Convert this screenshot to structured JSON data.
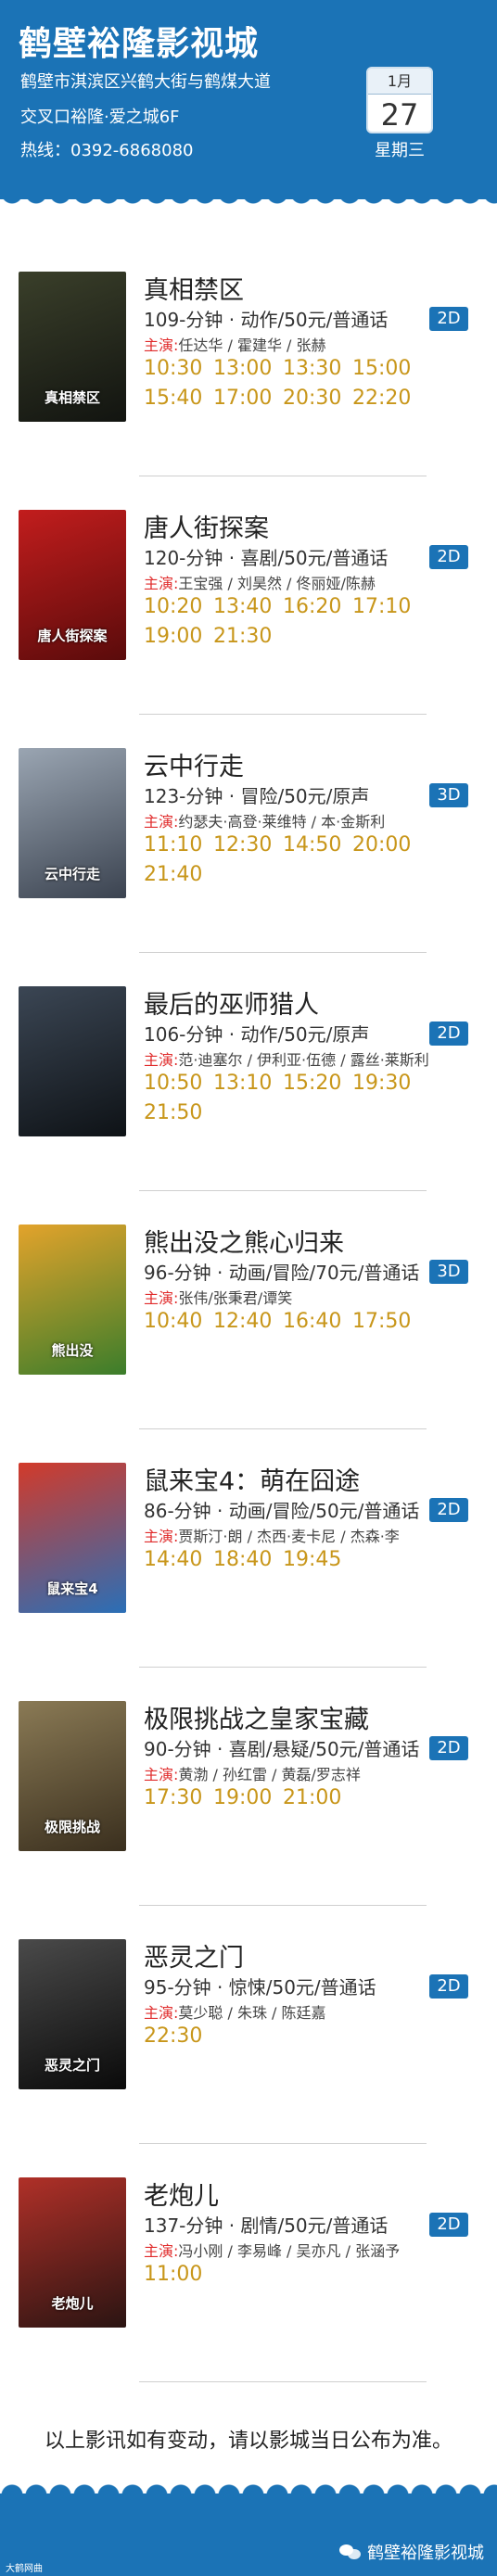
{
  "header": {
    "cinema_name": "鹤壁裕隆影视城",
    "address_line1": "鹤壁市淇滨区兴鹤大街与鹤煤大道",
    "address_line2": "交叉口裕隆·爱之城6F",
    "hotline": "热线：0392-6868080",
    "date_month": "1月",
    "date_day": "27",
    "weekday": "星期三"
  },
  "movies": [
    {
      "title": "真相禁区",
      "info": "109-分钟 · 动作/50元/普通话",
      "format": "2D",
      "cast_label": "主演:",
      "cast": "任达华 / 霍建华 / 张赫",
      "poster_text": "真相禁区",
      "poster_colors": [
        "#3a3f2a",
        "#121410"
      ],
      "times": [
        "10:30",
        "13:00",
        "13:30",
        "15:00",
        "15:40",
        "17:00",
        "20:30",
        "22:20"
      ]
    },
    {
      "title": "唐人街探案",
      "info": "120-分钟 · 喜剧/50元/普通话",
      "format": "2D",
      "cast_label": "主演:",
      "cast": "王宝强 / 刘昊然 / 佟丽娅/陈赫",
      "poster_text": "唐人街探案",
      "poster_colors": [
        "#c21d1d",
        "#5a0b0b"
      ],
      "times": [
        "10:20",
        "13:40",
        "16:20",
        "17:10",
        "19:00",
        "21:30"
      ]
    },
    {
      "title": "云中行走",
      "info": "123-分钟 · 冒险/50元/原声",
      "format": "3D",
      "cast_label": "主演:",
      "cast": "约瑟夫·高登·莱维特 / 本·金斯利",
      "poster_text": "云中行走",
      "poster_colors": [
        "#9aa5b2",
        "#3b4350"
      ],
      "times": [
        "11:10",
        "12:30",
        "14:50",
        "20:00",
        "21:40"
      ]
    },
    {
      "title": "最后的巫师猎人",
      "info": "106-分钟 · 动作/50元/原声",
      "format": "2D",
      "cast_label": "主演:",
      "cast": "范·迪塞尔 / 伊利亚·伍德 / 露丝·莱斯利",
      "poster_text": "",
      "poster_colors": [
        "#3b4654",
        "#0e1216"
      ],
      "times": [
        "10:50",
        "13:10",
        "15:20",
        "19:30",
        "21:50"
      ]
    },
    {
      "title": "熊出没之熊心归来",
      "info": "96-分钟 · 动画/冒险/70元/普通话",
      "format": "3D",
      "cast_label": "主演:",
      "cast": "张伟/张秉君/谭笑",
      "poster_text": "熊出没",
      "poster_colors": [
        "#e3a32b",
        "#3b7d2b"
      ],
      "times": [
        "10:40",
        "12:40",
        "16:40",
        "17:50"
      ]
    },
    {
      "title": "鼠来宝4：萌在囧途",
      "info": "86-分钟 · 动画/冒险/50元/普通话",
      "format": "2D",
      "cast_label": "主演:",
      "cast": "贾斯汀·朗 / 杰西·麦卡尼 / 杰森·李",
      "poster_text": "鼠来宝4",
      "poster_colors": [
        "#d23a2a",
        "#2a6fb7"
      ],
      "times": [
        "14:40",
        "18:40",
        "19:45"
      ]
    },
    {
      "title": "极限挑战之皇家宝藏",
      "info": "90-分钟 · 喜剧/悬疑/50元/普通话",
      "format": "2D",
      "cast_label": "主演:",
      "cast": "黄渤 / 孙红雷 / 黄磊/罗志祥",
      "poster_text": "极限挑战",
      "poster_colors": [
        "#8a7a55",
        "#3a2f1e"
      ],
      "times": [
        "17:30",
        "19:00",
        "21:00"
      ]
    },
    {
      "title": "恶灵之门",
      "info": "95-分钟 · 惊悚/50元/普通话",
      "format": "2D",
      "cast_label": "主演:",
      "cast": "莫少聪 / 朱珠 / 陈廷嘉",
      "poster_text": "恶灵之门",
      "poster_colors": [
        "#4a4a4a",
        "#0a0a0a"
      ],
      "times": [
        "22:30"
      ]
    },
    {
      "title": "老炮儿",
      "info": "137-分钟 · 剧情/50元/普通话",
      "format": "2D",
      "cast_label": "主演:",
      "cast": "冯小刚 / 李易峰 / 吴亦凡 / 张涵予",
      "poster_text": "老炮儿",
      "poster_colors": [
        "#b03028",
        "#2a1412"
      ],
      "times": [
        "11:00"
      ]
    }
  ],
  "footer": {
    "notice": "以上影讯如有变动，请以影城当日公布为准。",
    "watermark_left": "大鹤网曲",
    "account_name": "鹤壁裕隆影视城"
  },
  "colors": {
    "brand_blue": "#1b73b6",
    "showtime_gold": "#c8961a",
    "cast_label_red": "#e02b2b"
  }
}
